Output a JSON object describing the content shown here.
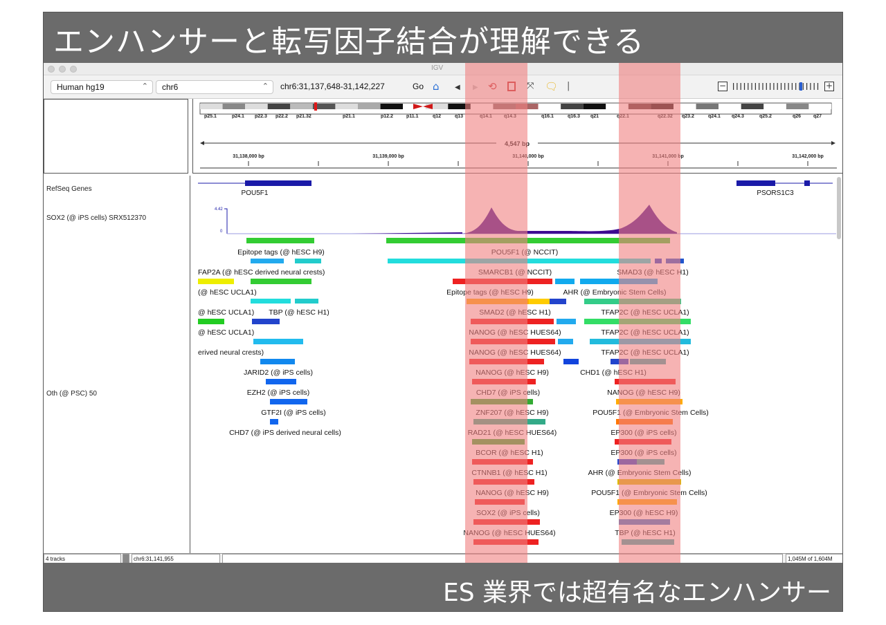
{
  "slide": {
    "title": "エンハンサーと転写因子結合が理解できる",
    "caption": "ES 業界では超有名なエンハンサー"
  },
  "app": {
    "title": "IGV"
  },
  "toolbar": {
    "genome": "Human hg19",
    "chromosome": "chr6",
    "locus": "chr6:31,137,648-31,142,227",
    "go_label": "Go",
    "icons": [
      "home-icon",
      "back-icon",
      "forward-icon",
      "refresh-icon",
      "roi-icon",
      "resize-icon",
      "popup-icon"
    ]
  },
  "ideogram": {
    "bands": [
      "p25.1",
      "p24.1",
      "p22.3",
      "p22.2",
      "p21.32",
      "p21.1",
      "p12.2",
      "p11.1",
      "q12",
      "q13",
      "q14.1",
      "q14.3",
      "q16.1",
      "q16.3",
      "q21",
      "q22.1",
      "q22.32",
      "q23.2",
      "q24.1",
      "q24.3",
      "q25.2",
      "q26",
      "q27"
    ]
  },
  "ruler": {
    "span": "4,547 bp",
    "ticks": [
      "31,138,000 bp",
      "31,139,000 bp",
      "31,140,000 bp",
      "31,141,000 bp",
      "31,142,000 bp"
    ]
  },
  "tracks": {
    "refseq": {
      "name": "RefSeq Genes",
      "genes": [
        "POU5F1",
        "PSORS1C3"
      ]
    },
    "signal": {
      "name": "SOX2 (@ iPS cells) SRX512370",
      "scale_max": "4.42",
      "scale_min": "0"
    },
    "oth": {
      "name": "Oth (@ PSC) 50"
    }
  },
  "features": [
    {
      "label": "Epitope tags (@ hESC H9)"
    },
    {
      "label": "POU5F1 (@ NCCIT)"
    },
    {
      "label": "FAP2A (@ hESC derived neural crests)"
    },
    {
      "label": "SMARCB1 (@ NCCIT)"
    },
    {
      "label": "SMAD3 (@ hESC H1)"
    },
    {
      "label": "(@ hESC UCLA1)"
    },
    {
      "label": "Epitope tags (@ hESC H9)"
    },
    {
      "label": "AHR (@ Embryonic Stem Cells)"
    },
    {
      "label": "@ hESC UCLA1)"
    },
    {
      "label": "TBP (@ hESC H1)"
    },
    {
      "label": "SMAD2 (@ hESC H1)"
    },
    {
      "label": "TFAP2C (@ hESC UCLA1)"
    },
    {
      "label": "@ hESC UCLA1)"
    },
    {
      "label": "NANOG (@ hESC HUES64)"
    },
    {
      "label": "TFAP2C (@ hESC UCLA1)"
    },
    {
      "label": "erived neural crests)"
    },
    {
      "label": "NANOG (@ hESC HUES64)"
    },
    {
      "label": "TFAP2C (@ hESC UCLA1)"
    },
    {
      "label": "JARID2 (@ iPS cells)"
    },
    {
      "label": "NANOG (@ hESC H9)"
    },
    {
      "label": "CHD1 (@ hESC H1)"
    },
    {
      "label": "EZH2 (@ iPS cells)"
    },
    {
      "label": "CHD7 (@ iPS cells)"
    },
    {
      "label": "NANOG (@ hESC H9)"
    },
    {
      "label": "GTF2I (@ iPS cells)"
    },
    {
      "label": "ZNF207 (@ hESC H9)"
    },
    {
      "label": "POU5F1 (@ Embryonic Stem Cells)"
    },
    {
      "label": "CHD7 (@ iPS derived neural cells)"
    },
    {
      "label": "RAD21 (@ hESC HUES64)"
    },
    {
      "label": "EP300 (@ iPS cells)"
    },
    {
      "label": "BCOR (@ hESC H1)"
    },
    {
      "label": "EP300 (@ iPS cells)"
    },
    {
      "label": "CTNNB1 (@ hESC H1)"
    },
    {
      "label": "AHR (@ Embryonic Stem Cells)"
    },
    {
      "label": "NANOG (@ hESC H9)"
    },
    {
      "label": "POU5F1 (@ Embryonic Stem Cells)"
    },
    {
      "label": "SOX2 (@ iPS cells)"
    },
    {
      "label": "EP300 (@ hESC H9)"
    },
    {
      "label": "NANOG (@ hESC HUES64)"
    },
    {
      "label": "TBP (@ hESC H1)"
    }
  ],
  "status": {
    "tracks": "4 tracks",
    "position": "chr6:31,141,955",
    "memory": "1,045M of 1,604M"
  },
  "colors": {
    "highlight": "#f08080",
    "banner": "#6b6b6b",
    "gene": "#1a1aa8",
    "signal": "#3d0a91"
  }
}
